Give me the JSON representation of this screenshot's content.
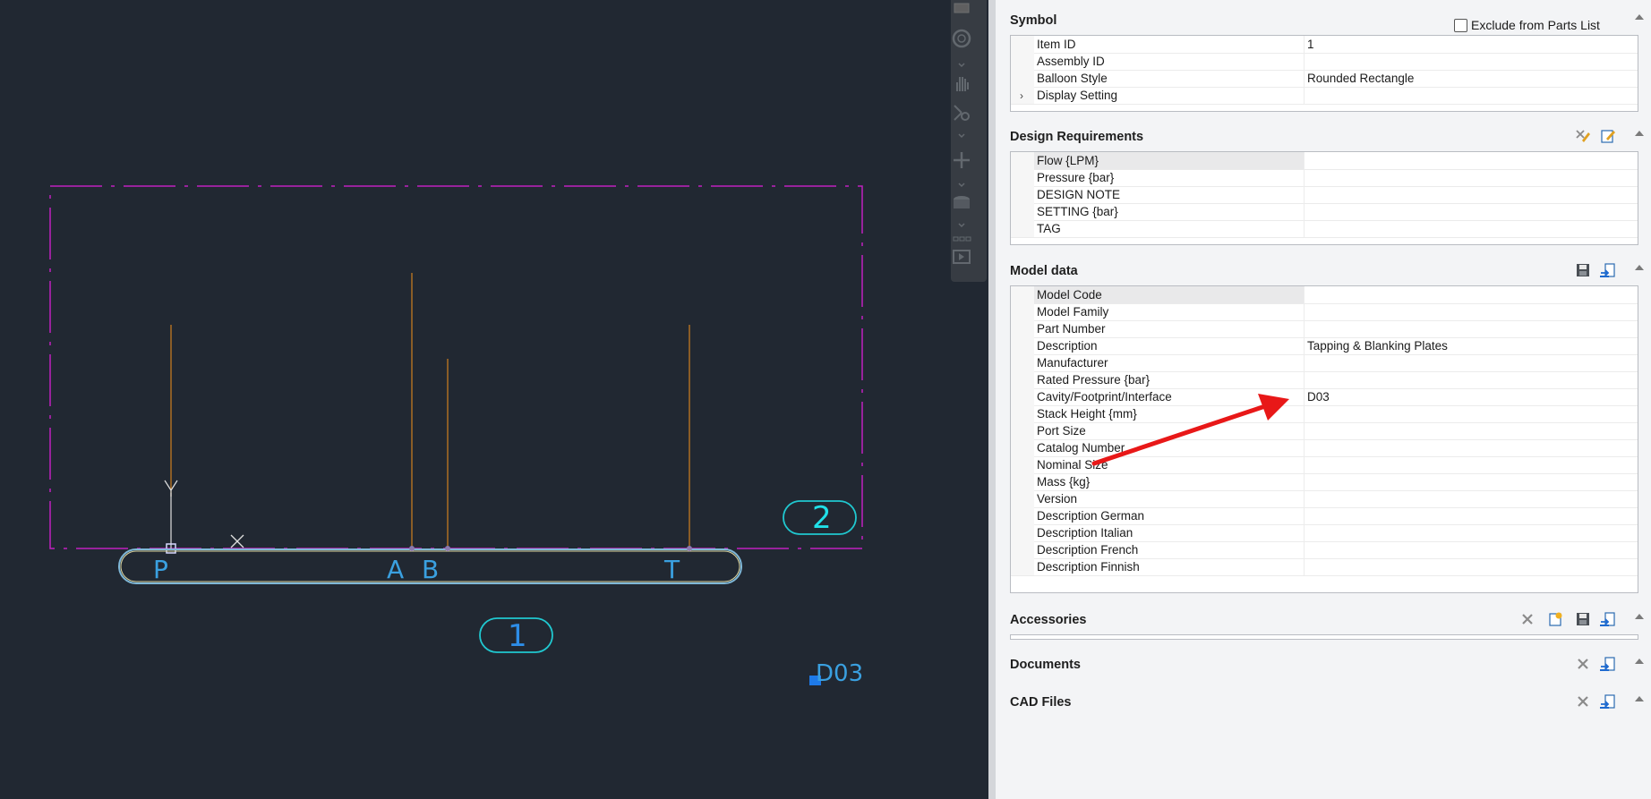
{
  "canvas": {
    "port_labels": [
      "P",
      "A",
      "B",
      "T"
    ],
    "balloon_1": "1",
    "balloon_2": "2",
    "interface_label": "D03",
    "ucs_axis_label": "Y",
    "colors": {
      "background": "#212832",
      "border": "#c020c0",
      "lines": "#d08020",
      "balloon": "#20c8d0",
      "label": "#3aa0e0"
    }
  },
  "symbol": {
    "title": "Symbol",
    "exclude_label": "Exclude from Parts List",
    "rows": [
      {
        "label": "Item ID",
        "value": "1"
      },
      {
        "label": "Assembly ID",
        "value": ""
      },
      {
        "label": "Balloon Style",
        "value": "Rounded Rectangle"
      },
      {
        "label": "Display Setting",
        "value": ""
      }
    ]
  },
  "design": {
    "title": "Design Requirements",
    "rows": [
      {
        "label": "Flow {LPM}",
        "value": ""
      },
      {
        "label": "Pressure {bar}",
        "value": ""
      },
      {
        "label": "DESIGN NOTE",
        "value": ""
      },
      {
        "label": "SETTING {bar}",
        "value": ""
      },
      {
        "label": "TAG",
        "value": ""
      }
    ]
  },
  "model": {
    "title": "Model data",
    "rows": [
      {
        "label": "Model Code",
        "value": ""
      },
      {
        "label": "Model Family",
        "value": ""
      },
      {
        "label": "Part Number",
        "value": ""
      },
      {
        "label": "Description",
        "value": "Tapping & Blanking Plates"
      },
      {
        "label": "Manufacturer",
        "value": ""
      },
      {
        "label": "Rated Pressure {bar}",
        "value": ""
      },
      {
        "label": "Cavity/Footprint/Interface",
        "value": "D03"
      },
      {
        "label": "Stack Height {mm}",
        "value": ""
      },
      {
        "label": "Port Size",
        "value": ""
      },
      {
        "label": "Catalog Number",
        "value": ""
      },
      {
        "label": "Nominal Size",
        "value": ""
      },
      {
        "label": "Mass {kg}",
        "value": ""
      },
      {
        "label": "Version",
        "value": ""
      },
      {
        "label": "Description German",
        "value": ""
      },
      {
        "label": "Description Italian",
        "value": ""
      },
      {
        "label": "Description French",
        "value": ""
      },
      {
        "label": "Description Finnish",
        "value": ""
      }
    ]
  },
  "accessories": {
    "title": "Accessories"
  },
  "documents": {
    "title": "Documents"
  },
  "cadfiles": {
    "title": "CAD Files"
  }
}
